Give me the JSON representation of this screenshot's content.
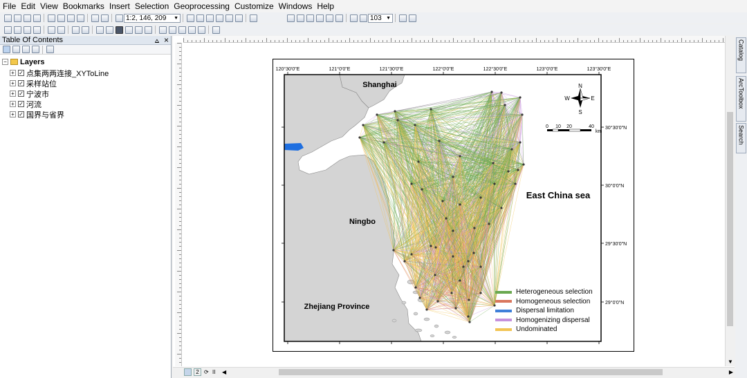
{
  "menu": [
    "File",
    "Edit",
    "View",
    "Bookmarks",
    "Insert",
    "Selection",
    "Geoprocessing",
    "Customize",
    "Windows",
    "Help"
  ],
  "toolbar": {
    "scale": "1:2, 146, 209",
    "zoom_percent": "103"
  },
  "toc": {
    "title": "Table Of Contents",
    "pin": "⩟",
    "close": "×",
    "root": "Layers",
    "layers": [
      "点集两两连接_XYToLine",
      "采样站位",
      "宁波市",
      "河流",
      "国界与省界"
    ]
  },
  "dock": {
    "catalog": "Catalog",
    "arctoolbox": "ArcToolbox",
    "search": "Search"
  },
  "statusbar": {
    "page_indicator": "2"
  },
  "map": {
    "lon_labels": [
      "120°30'0\"E",
      "121°0'0\"E",
      "121°30'0\"E",
      "122°0'0\"E",
      "122°30'0\"E",
      "123°0'0\"E",
      "123°30'0\"E"
    ],
    "lat_labels": [
      "30°30'0\"N",
      "30°0'0\"N",
      "29°30'0\"N",
      "29°0'0\"N"
    ],
    "places": {
      "shanghai": "Shanghai",
      "ningbo": "Ningbo",
      "zhejiang": "Zhejiang Province",
      "sea": "East China sea"
    },
    "north": {
      "n": "N",
      "s": "S",
      "e": "E",
      "w": "W"
    },
    "scalebar": {
      "ticks": [
        "0",
        "10",
        "20",
        "40"
      ],
      "unit": "km"
    },
    "legend": [
      {
        "label": "Heterogeneous selection",
        "color": "#6aa84f"
      },
      {
        "label": "Homogeneous selection",
        "color": "#d9775e"
      },
      {
        "label": "Dispersal limitation",
        "color": "#3f7fd9"
      },
      {
        "label": "Homogenizing dispersal",
        "color": "#c591dd"
      },
      {
        "label": "Undominated",
        "color": "#f2c453"
      }
    ]
  },
  "colors": {
    "land": "#d4d4d4",
    "river": "#1f6fe0",
    "green_network": "#6aa84f",
    "yellow_network": "#f2c453",
    "purple_network": "#c591dd",
    "red_network": "#d9775e"
  }
}
